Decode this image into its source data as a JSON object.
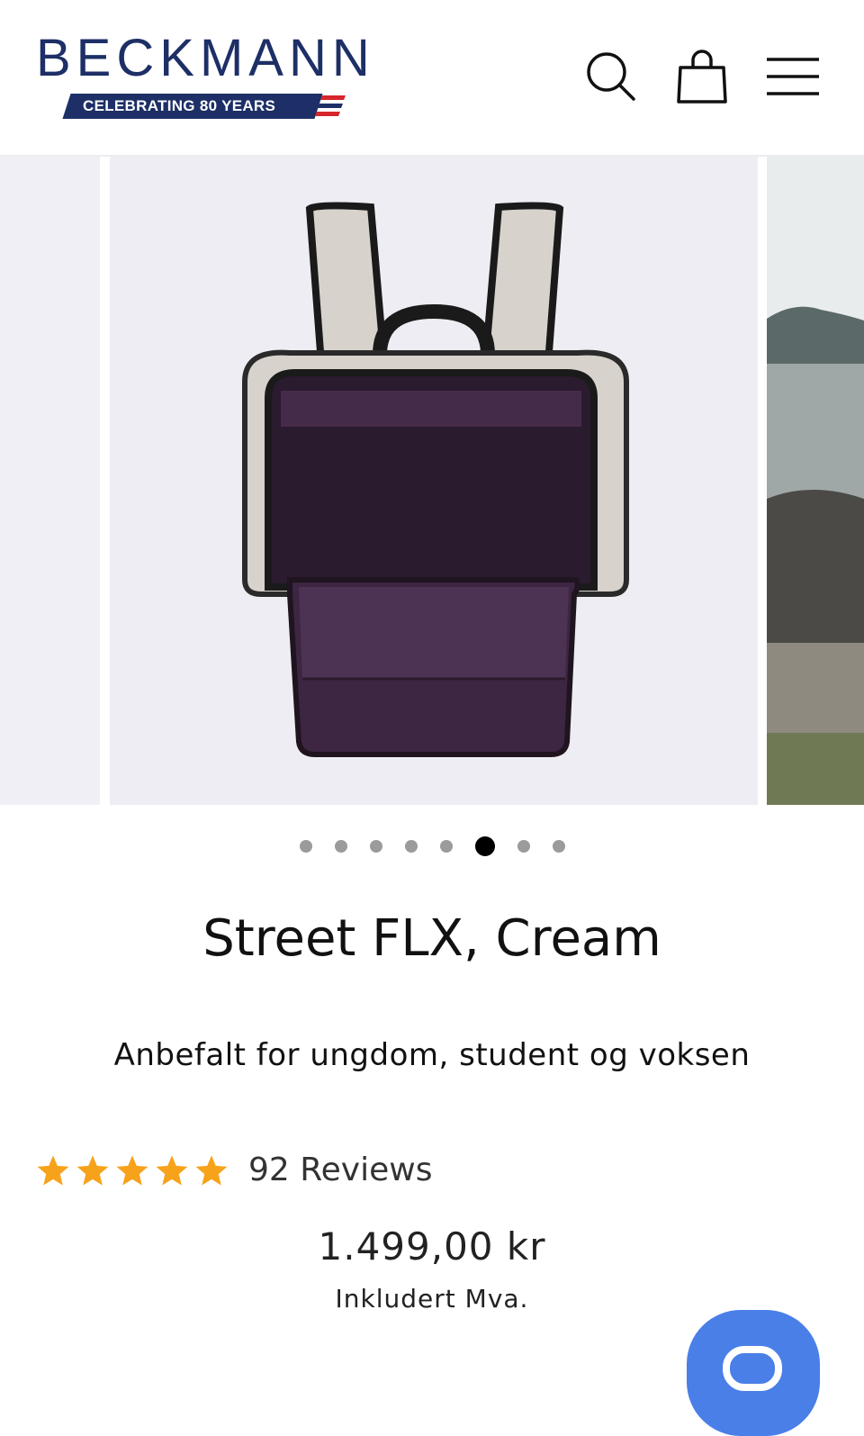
{
  "header": {
    "brand": "BECKMANN",
    "tagline": "CELEBRATING 80 YEARS",
    "icons": [
      "search-icon",
      "shopping-bag-icon",
      "menu-icon"
    ]
  },
  "gallery": {
    "zoom_icon": "zoom-icon",
    "dots_total": 8,
    "active_index": 5
  },
  "product": {
    "title": "Street FLX, Cream",
    "subtitle": "Anbefalt for ungdom, student og voksen",
    "rating": 5,
    "reviews": "92 Reviews",
    "price": "1.499,00 kr",
    "vat_note": "Inkludert Mva."
  },
  "colors": {
    "brand_navy": "#1d2f66",
    "star": "#f7a21b",
    "chat": "#4a7fe8"
  }
}
